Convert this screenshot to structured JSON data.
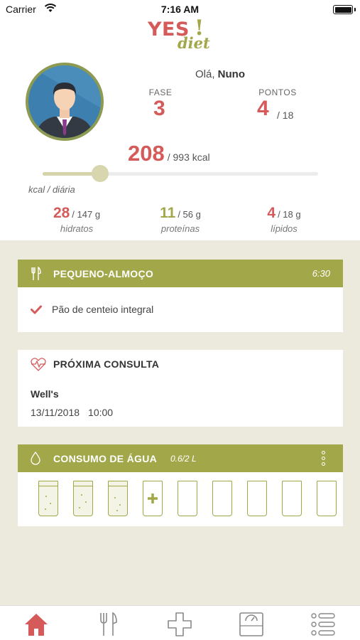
{
  "status_bar": {
    "carrier": "Carrier",
    "time": "7:16 AM"
  },
  "logo": {
    "yes": "YES",
    "excl": "!",
    "diet": "diet"
  },
  "user": {
    "greeting": "Olá,",
    "name": "Nuno"
  },
  "phase": {
    "label": "FASE",
    "value": "3"
  },
  "points": {
    "label": "PONTOS",
    "value": "4",
    "total": "/ 18"
  },
  "calories": {
    "value": "208",
    "total": "/ 993 kcal",
    "label": "kcal / diária",
    "progress": 0.21
  },
  "macros": [
    {
      "value": "28",
      "total": "/ 147 g",
      "name": "hidratos",
      "color": "#d55a5a"
    },
    {
      "value": "11",
      "total": "/ 56 g",
      "name": "proteínas",
      "color": "#a2a849"
    },
    {
      "value": "4",
      "total": "/ 18 g",
      "name": "lípidos",
      "color": "#d55a5a"
    }
  ],
  "meal": {
    "title": "PEQUENO-ALMOÇO",
    "time": "6:30",
    "items": [
      "Pão de centeio integral"
    ]
  },
  "consult": {
    "title": "PRÓXIMA CONSULTA",
    "place": "Well's",
    "date": "13/11/2018",
    "time": "10:00"
  },
  "water": {
    "title": "CONSUMO DE ÁGUA",
    "amount": "0.6/2 L",
    "glasses_full": 3,
    "glasses_total": 9
  },
  "tabs": [
    {
      "name": "home",
      "icon": "home-icon",
      "active": true
    },
    {
      "name": "meals",
      "icon": "fork-knife-icon",
      "active": false
    },
    {
      "name": "add",
      "icon": "plus-icon",
      "active": false
    },
    {
      "name": "scale",
      "icon": "scale-icon",
      "active": false
    },
    {
      "name": "menu",
      "icon": "list-icon",
      "active": false
    }
  ],
  "colors": {
    "accent_red": "#d55a5a",
    "accent_green": "#a2a849",
    "background": "#eceadc"
  }
}
